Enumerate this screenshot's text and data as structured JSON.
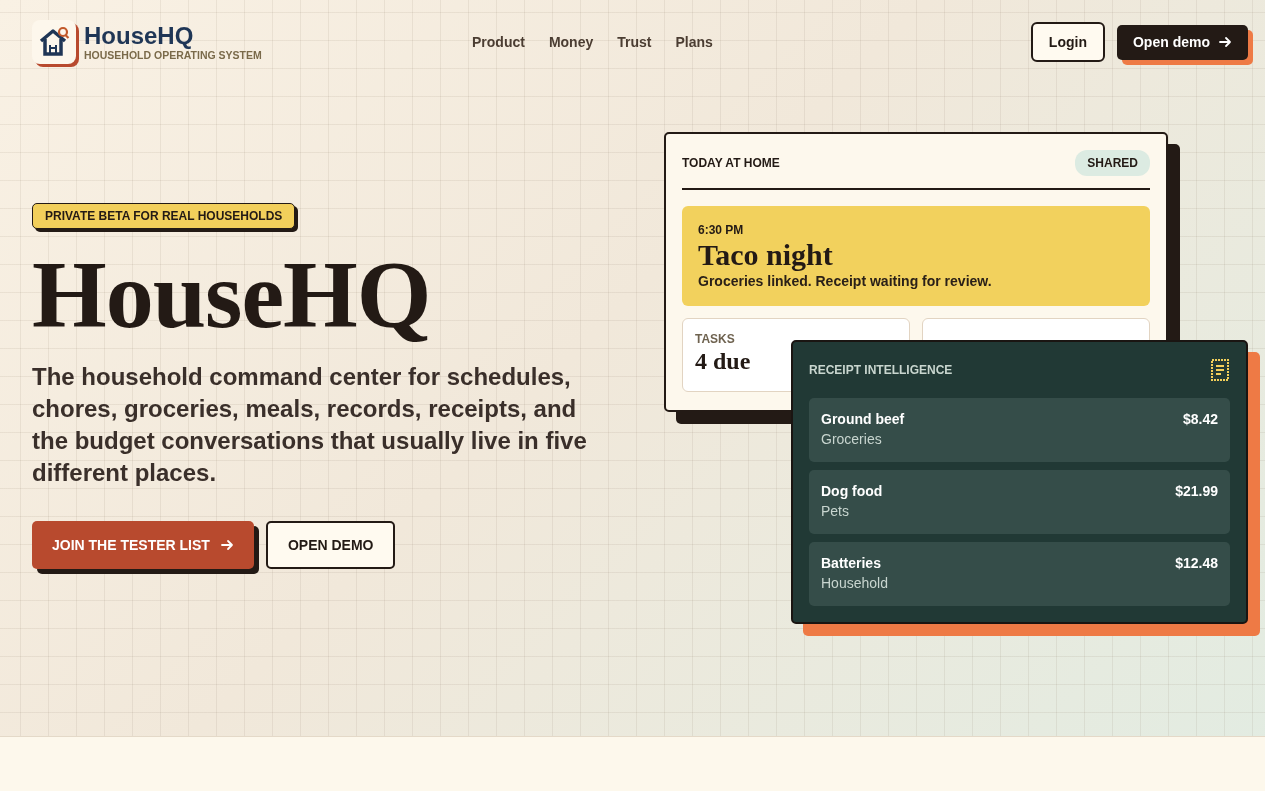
{
  "brand": {
    "name": "HouseHQ",
    "tagline": "HOUSEHOLD OPERATING SYSTEM"
  },
  "nav": [
    {
      "label": "Product"
    },
    {
      "label": "Money"
    },
    {
      "label": "Trust"
    },
    {
      "label": "Plans"
    }
  ],
  "header_actions": {
    "login": "Login",
    "demo": "Open demo"
  },
  "hero": {
    "badge": "PRIVATE BETA FOR REAL HOUSEHOLDS",
    "title": "HouseHQ",
    "lede": "The household command center for schedules, chores, groceries, meals, records, receipts, and the budget conversations that usually live in five different places.",
    "primary_button": "JOIN THE TESTER LIST",
    "secondary_button": "OPEN DEMO"
  },
  "today": {
    "title": "TODAY AT HOME",
    "tag": "SHARED",
    "event": {
      "time": "6:30 PM",
      "title": "Taco night",
      "note": "Groceries linked. Receipt waiting for review."
    },
    "stats": [
      {
        "label": "TASKS",
        "value": "4 due"
      }
    ]
  },
  "receipts": {
    "title": "RECEIPT INTELLIGENCE",
    "items": [
      {
        "name": "Ground beef",
        "category": "Groceries",
        "amount": "$8.42"
      },
      {
        "name": "Dog food",
        "category": "Pets",
        "amount": "$21.99"
      },
      {
        "name": "Batteries",
        "category": "Household",
        "amount": "$12.48"
      }
    ]
  }
}
